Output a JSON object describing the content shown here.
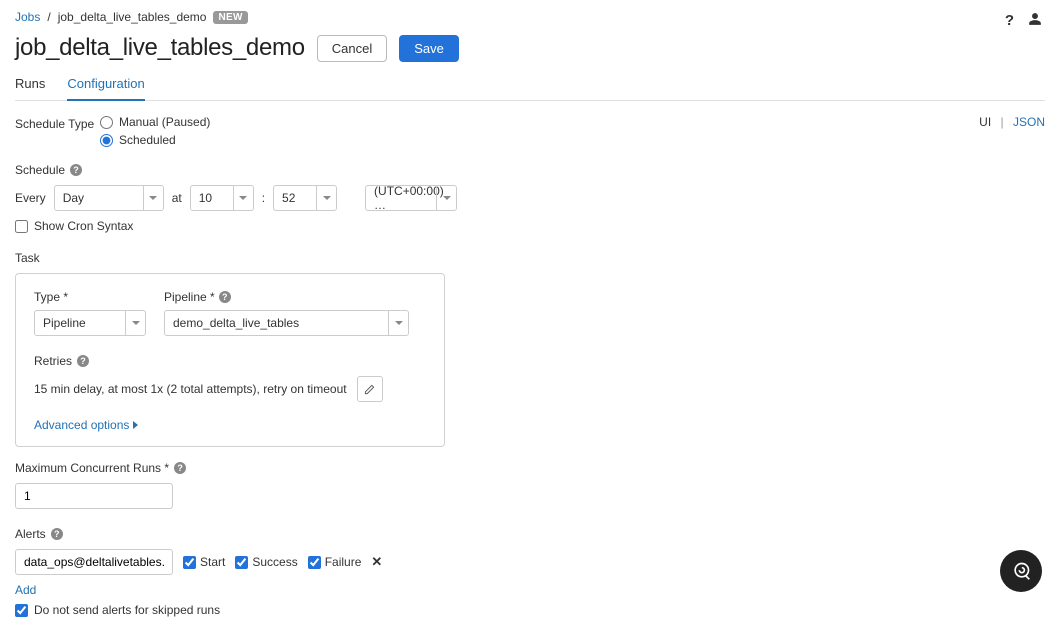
{
  "breadcrumb": {
    "root": "Jobs",
    "current": "job_delta_live_tables_demo",
    "badge": "NEW"
  },
  "header": {
    "title": "job_delta_live_tables_demo",
    "cancel": "Cancel",
    "save": "Save"
  },
  "tabs": {
    "runs": "Runs",
    "configuration": "Configuration"
  },
  "view_toggle": {
    "ui": "UI",
    "json": "JSON"
  },
  "schedule_type": {
    "label": "Schedule Type",
    "manual": "Manual (Paused)",
    "scheduled": "Scheduled"
  },
  "schedule": {
    "label": "Schedule",
    "every": "Every",
    "unit": "Day",
    "at": "at",
    "hour": "10",
    "colon": ":",
    "minute": "52",
    "timezone": "(UTC+00:00) …",
    "show_cron": "Show Cron Syntax"
  },
  "task": {
    "label": "Task",
    "type_label": "Type *",
    "type_value": "Pipeline",
    "pipeline_label": "Pipeline *",
    "pipeline_value": "demo_delta_live_tables",
    "retries_label": "Retries",
    "retries_text": "15 min delay, at most 1x (2 total attempts), retry on timeout",
    "advanced": "Advanced options"
  },
  "max_runs": {
    "label": "Maximum Concurrent Runs *",
    "value": "1"
  },
  "alerts": {
    "label": "Alerts",
    "email": "data_ops@deltalivetables.com",
    "start": "Start",
    "success": "Success",
    "failure": "Failure",
    "add": "Add",
    "skip": "Do not send alerts for skipped runs"
  }
}
